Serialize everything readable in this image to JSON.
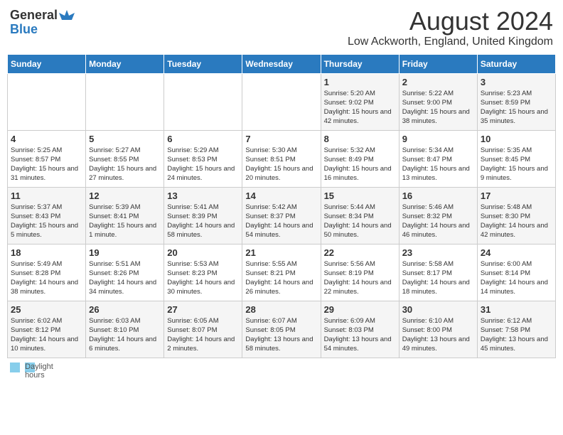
{
  "header": {
    "logo_general": "General",
    "logo_blue": "Blue",
    "month_year": "August 2024",
    "location": "Low Ackworth, England, United Kingdom"
  },
  "calendar": {
    "days_of_week": [
      "Sunday",
      "Monday",
      "Tuesday",
      "Wednesday",
      "Thursday",
      "Friday",
      "Saturday"
    ],
    "weeks": [
      [
        {
          "day": "",
          "info": ""
        },
        {
          "day": "",
          "info": ""
        },
        {
          "day": "",
          "info": ""
        },
        {
          "day": "",
          "info": ""
        },
        {
          "day": "1",
          "info": "Sunrise: 5:20 AM\nSunset: 9:02 PM\nDaylight: 15 hours\nand 42 minutes."
        },
        {
          "day": "2",
          "info": "Sunrise: 5:22 AM\nSunset: 9:00 PM\nDaylight: 15 hours\nand 38 minutes."
        },
        {
          "day": "3",
          "info": "Sunrise: 5:23 AM\nSunset: 8:59 PM\nDaylight: 15 hours\nand 35 minutes."
        }
      ],
      [
        {
          "day": "4",
          "info": "Sunrise: 5:25 AM\nSunset: 8:57 PM\nDaylight: 15 hours\nand 31 minutes."
        },
        {
          "day": "5",
          "info": "Sunrise: 5:27 AM\nSunset: 8:55 PM\nDaylight: 15 hours\nand 27 minutes."
        },
        {
          "day": "6",
          "info": "Sunrise: 5:29 AM\nSunset: 8:53 PM\nDaylight: 15 hours\nand 24 minutes."
        },
        {
          "day": "7",
          "info": "Sunrise: 5:30 AM\nSunset: 8:51 PM\nDaylight: 15 hours\nand 20 minutes."
        },
        {
          "day": "8",
          "info": "Sunrise: 5:32 AM\nSunset: 8:49 PM\nDaylight: 15 hours\nand 16 minutes."
        },
        {
          "day": "9",
          "info": "Sunrise: 5:34 AM\nSunset: 8:47 PM\nDaylight: 15 hours\nand 13 minutes."
        },
        {
          "day": "10",
          "info": "Sunrise: 5:35 AM\nSunset: 8:45 PM\nDaylight: 15 hours\nand 9 minutes."
        }
      ],
      [
        {
          "day": "11",
          "info": "Sunrise: 5:37 AM\nSunset: 8:43 PM\nDaylight: 15 hours\nand 5 minutes."
        },
        {
          "day": "12",
          "info": "Sunrise: 5:39 AM\nSunset: 8:41 PM\nDaylight: 15 hours\nand 1 minute."
        },
        {
          "day": "13",
          "info": "Sunrise: 5:41 AM\nSunset: 8:39 PM\nDaylight: 14 hours\nand 58 minutes."
        },
        {
          "day": "14",
          "info": "Sunrise: 5:42 AM\nSunset: 8:37 PM\nDaylight: 14 hours\nand 54 minutes."
        },
        {
          "day": "15",
          "info": "Sunrise: 5:44 AM\nSunset: 8:34 PM\nDaylight: 14 hours\nand 50 minutes."
        },
        {
          "day": "16",
          "info": "Sunrise: 5:46 AM\nSunset: 8:32 PM\nDaylight: 14 hours\nand 46 minutes."
        },
        {
          "day": "17",
          "info": "Sunrise: 5:48 AM\nSunset: 8:30 PM\nDaylight: 14 hours\nand 42 minutes."
        }
      ],
      [
        {
          "day": "18",
          "info": "Sunrise: 5:49 AM\nSunset: 8:28 PM\nDaylight: 14 hours\nand 38 minutes."
        },
        {
          "day": "19",
          "info": "Sunrise: 5:51 AM\nSunset: 8:26 PM\nDaylight: 14 hours\nand 34 minutes."
        },
        {
          "day": "20",
          "info": "Sunrise: 5:53 AM\nSunset: 8:23 PM\nDaylight: 14 hours\nand 30 minutes."
        },
        {
          "day": "21",
          "info": "Sunrise: 5:55 AM\nSunset: 8:21 PM\nDaylight: 14 hours\nand 26 minutes."
        },
        {
          "day": "22",
          "info": "Sunrise: 5:56 AM\nSunset: 8:19 PM\nDaylight: 14 hours\nand 22 minutes."
        },
        {
          "day": "23",
          "info": "Sunrise: 5:58 AM\nSunset: 8:17 PM\nDaylight: 14 hours\nand 18 minutes."
        },
        {
          "day": "24",
          "info": "Sunrise: 6:00 AM\nSunset: 8:14 PM\nDaylight: 14 hours\nand 14 minutes."
        }
      ],
      [
        {
          "day": "25",
          "info": "Sunrise: 6:02 AM\nSunset: 8:12 PM\nDaylight: 14 hours\nand 10 minutes."
        },
        {
          "day": "26",
          "info": "Sunrise: 6:03 AM\nSunset: 8:10 PM\nDaylight: 14 hours\nand 6 minutes."
        },
        {
          "day": "27",
          "info": "Sunrise: 6:05 AM\nSunset: 8:07 PM\nDaylight: 14 hours\nand 2 minutes."
        },
        {
          "day": "28",
          "info": "Sunrise: 6:07 AM\nSunset: 8:05 PM\nDaylight: 13 hours\nand 58 minutes."
        },
        {
          "day": "29",
          "info": "Sunrise: 6:09 AM\nSunset: 8:03 PM\nDaylight: 13 hours\nand 54 minutes."
        },
        {
          "day": "30",
          "info": "Sunrise: 6:10 AM\nSunset: 8:00 PM\nDaylight: 13 hours\nand 49 minutes."
        },
        {
          "day": "31",
          "info": "Sunrise: 6:12 AM\nSunset: 7:58 PM\nDaylight: 13 hours\nand 45 minutes."
        }
      ]
    ]
  },
  "legend": {
    "label": "Daylight hours"
  }
}
